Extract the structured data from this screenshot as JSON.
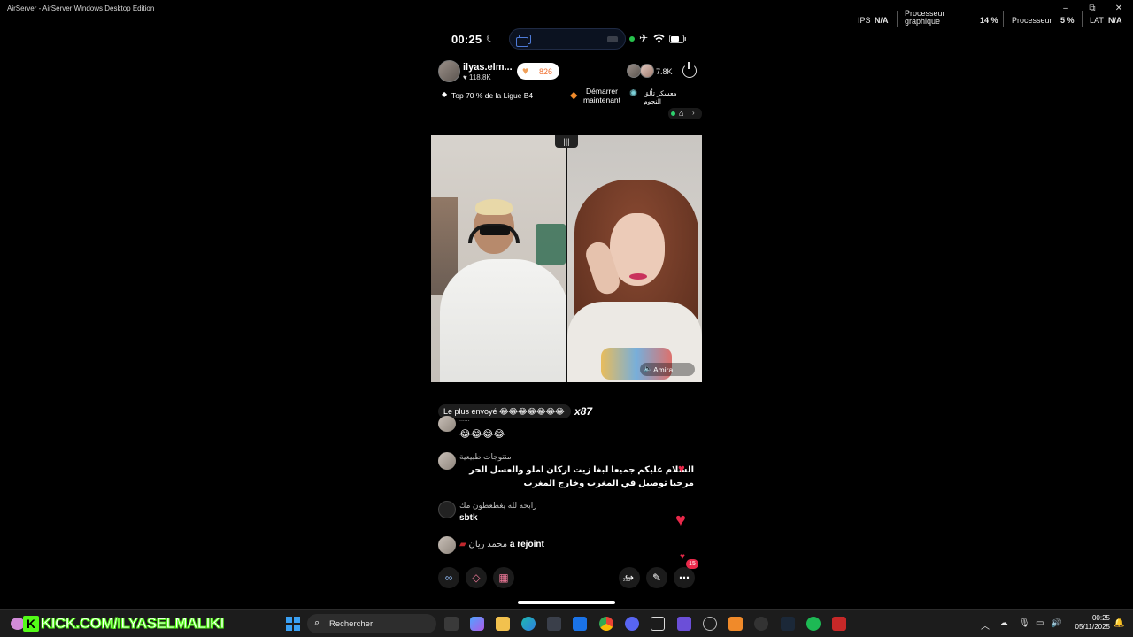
{
  "window": {
    "title": "AirServer - AirServer Windows Desktop Edition",
    "controls": [
      "–",
      "⧉",
      "✕"
    ]
  },
  "perf": {
    "ips_label": "IPS",
    "ips_value": "N/A",
    "gpu_label_1": "Processeur",
    "gpu_label_2": "graphique",
    "gpu_value": "14 %",
    "cpu_label": "Processeur",
    "cpu_value": "5 %",
    "lat_label": "LAT",
    "lat_value": "N/A"
  },
  "phone_status": {
    "time": "00:25",
    "moon_icon": "☾",
    "island_tag": "",
    "airplane_icon": "✈",
    "wifi_icon": "wifi",
    "battery_icon": "battery"
  },
  "live_header": {
    "username": "ilyas.elm...",
    "likes": "118.8K",
    "coins": "826",
    "viewers": "7.8K"
  },
  "chips": {
    "rank": "Top 70 % de la Ligue B4",
    "start_line1": "Démarrer",
    "start_line2": "maintenant",
    "camp": "معسكر تألق النجوم"
  },
  "video": {
    "split_handle": "|||",
    "guest_name": "Amira ."
  },
  "gift_banner": {
    "text": "Le plus envoyé 😂😂😂😂😂😂😂",
    "multiplier": "x87"
  },
  "comments": [
    {
      "user": "......",
      "text": "😂😂😂😂"
    },
    {
      "user": "منتوجات طبيعية",
      "text": "السلام عليكم جميعا لبغا زيت اركان املو والعسل الحر مرحبا توصيل في المغرب وخارج المغرب"
    },
    {
      "user": "رابحه لله يغطعطون مك",
      "text": "sbtk"
    }
  ],
  "join_notice": {
    "user": "محمد ريان",
    "text": "a rejoint"
  },
  "toolbar": {
    "badge": "15",
    "share_count": "293"
  },
  "taskbar": {
    "overlay_text": "KICK.COM/ILYASELMALIKI",
    "search_placeholder": "Rechercher",
    "time": "00:25",
    "date": "05/11/2025"
  },
  "colors": {
    "kick_green": "#53fc18",
    "heart_red": "#e8294a",
    "coin_orange": "#f07030"
  }
}
